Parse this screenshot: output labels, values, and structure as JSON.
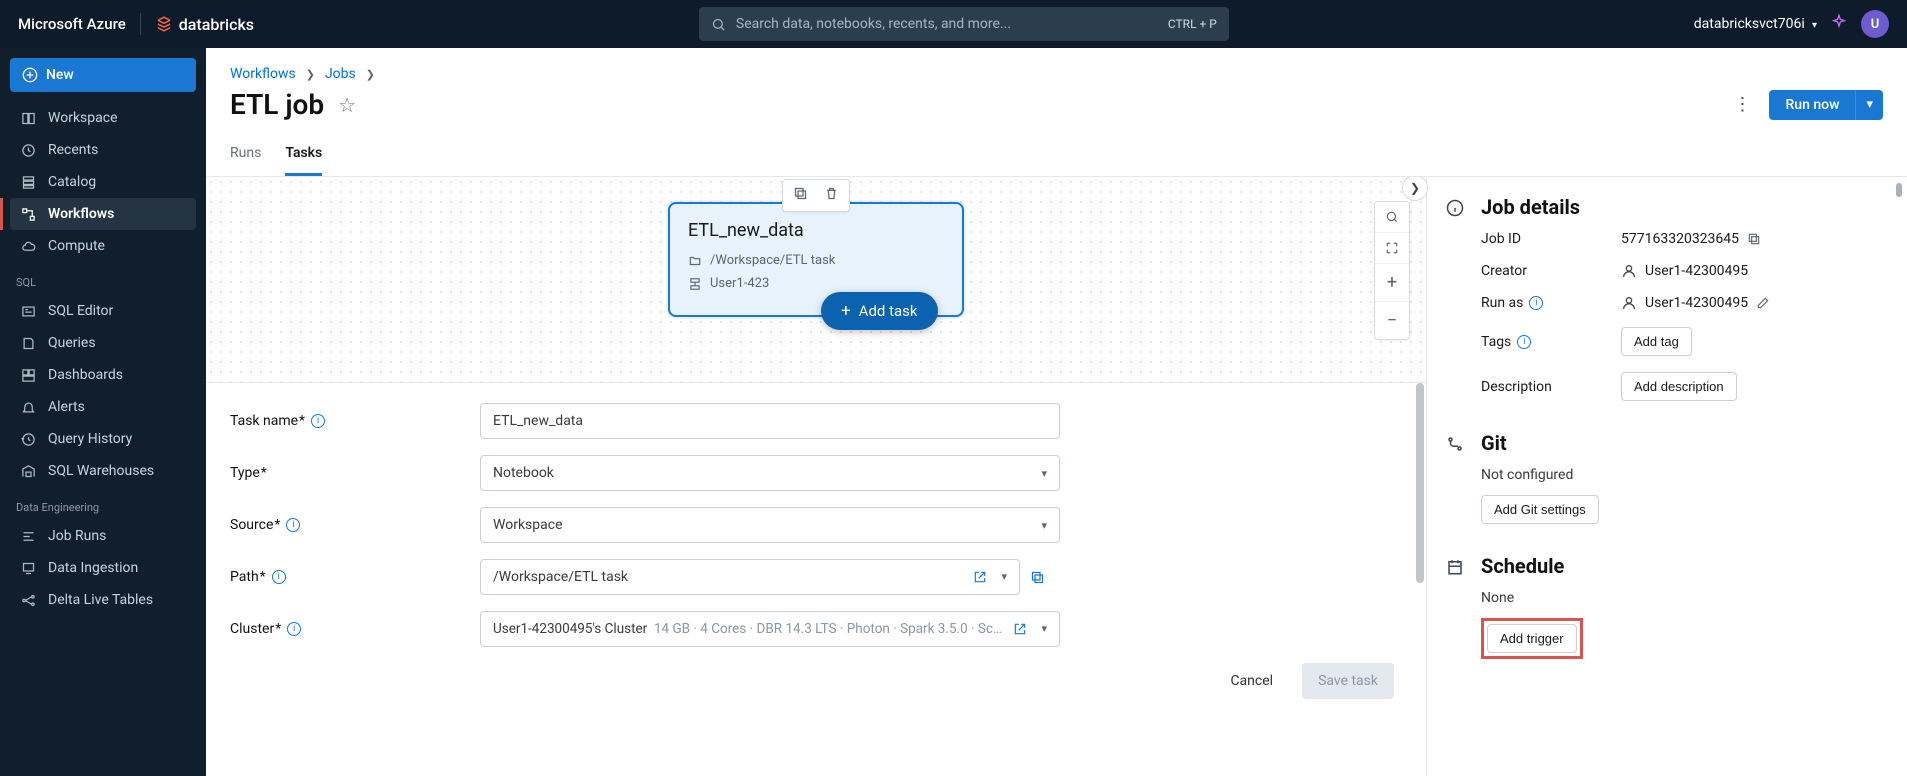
{
  "header": {
    "azure": "Microsoft Azure",
    "brand": "databricks",
    "searchPlaceholder": "Search data, notebooks, recents, and more...",
    "shortcut": "CTRL + P",
    "userWorkspace": "databricksvct706i",
    "avatar": "U"
  },
  "sidebar": {
    "newLabel": "New",
    "items1": [
      "Workspace",
      "Recents",
      "Catalog",
      "Workflows",
      "Compute"
    ],
    "sqlLabel": "SQL",
    "sqlItems": [
      "SQL Editor",
      "Queries",
      "Dashboards",
      "Alerts",
      "Query History",
      "SQL Warehouses"
    ],
    "deLabel": "Data Engineering",
    "deItems": [
      "Job Runs",
      "Data Ingestion",
      "Delta Live Tables"
    ]
  },
  "breadcrumb": {
    "a": "Workflows",
    "b": "Jobs"
  },
  "job": {
    "title": "ETL job"
  },
  "actions": {
    "runNow": "Run now"
  },
  "tabs": {
    "runs": "Runs",
    "tasks": "Tasks"
  },
  "taskNode": {
    "title": "ETL_new_data",
    "path": "/Workspace/ETL task",
    "clusterShort": "User1-423"
  },
  "addTask": "Add task",
  "form": {
    "taskNameLabel": "Task name",
    "taskName": "ETL_new_data",
    "typeLabel": "Type",
    "type": "Notebook",
    "sourceLabel": "Source",
    "source": "Workspace",
    "pathLabel": "Path",
    "path": "/Workspace/ETL task",
    "clusterLabel": "Cluster",
    "clusterName": "User1-42300495's Cluster",
    "clusterSpec": "14 GB · 4 Cores · DBR 14.3 LTS · Photon · Spark 3.5.0 · Sc…",
    "cancel": "Cancel",
    "save": "Save task"
  },
  "details": {
    "sectionTitle": "Job details",
    "jobIdLabel": "Job ID",
    "jobId": "577163320323645",
    "creatorLabel": "Creator",
    "user": "User1-42300495",
    "runAsLabel": "Run as",
    "tagsLabel": "Tags",
    "addTag": "Add tag",
    "descLabel": "Description",
    "addDesc": "Add description",
    "gitTitle": "Git",
    "gitStatus": "Not configured",
    "gitBtn": "Add Git settings",
    "scheduleTitle": "Schedule",
    "scheduleStatus": "None",
    "addTrigger": "Add trigger"
  }
}
